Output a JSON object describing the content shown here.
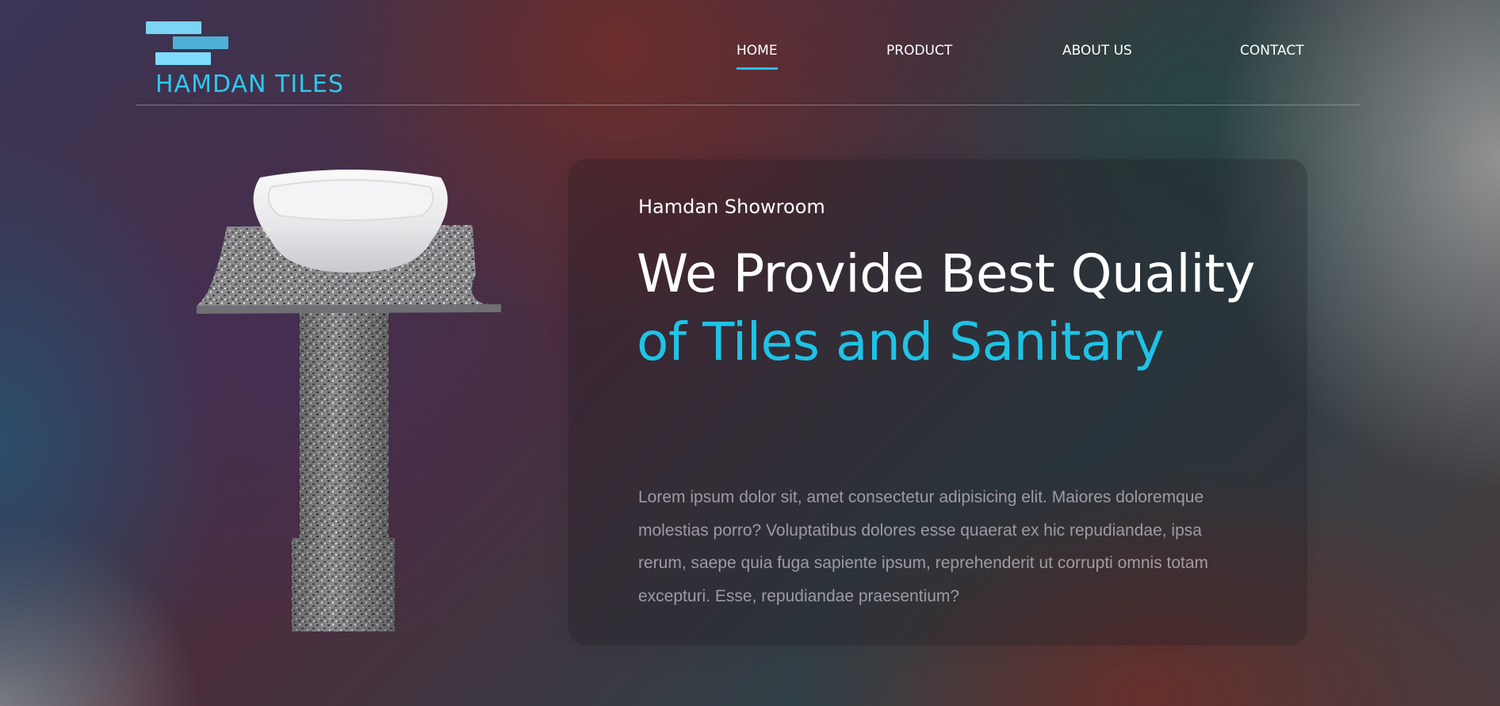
{
  "brand": {
    "name": "HAMDAN TILES",
    "logo_icon": "stacked-tiles-logo",
    "colors": {
      "accent": "#1ec3e6",
      "logo_light": "#7dd3f3",
      "logo_mid": "#4fb0d6"
    }
  },
  "nav": {
    "items": [
      {
        "label": "HOME",
        "active": true
      },
      {
        "label": "PRODUCT",
        "active": false
      },
      {
        "label": "ABOUT US",
        "active": false
      },
      {
        "label": "CONTACT",
        "active": false
      }
    ]
  },
  "hero": {
    "image": "granite-pedestal-sink",
    "eyebrow": "Hamdan Showroom",
    "headline_white": "We Provide Best Quality ",
    "headline_accent": "of Tiles and Sanitary",
    "description": "Lorem ipsum dolor sit, amet consectetur adipisicing elit. Maiores doloremque molestias porro? Voluptatibus dolores esse quaerat ex hic repudiandae, ipsa rerum, saepe quia fuga sapiente ipsum, reprehenderit ut corrupti omnis totam excepturi. Esse, repudiandae praesentium?"
  }
}
